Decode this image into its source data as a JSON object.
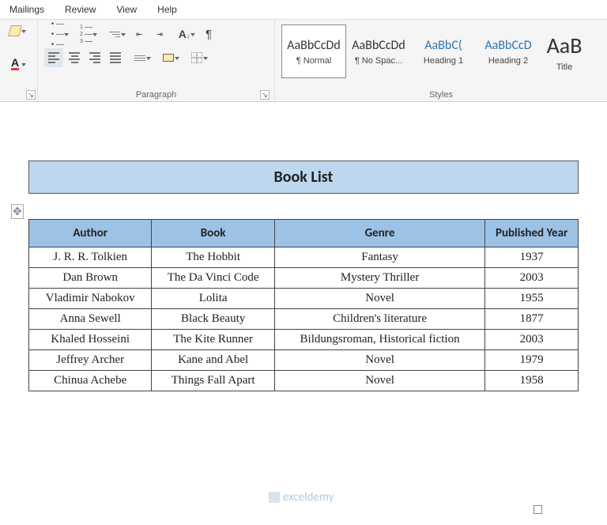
{
  "tabs": {
    "mailings": "Mailings",
    "review": "Review",
    "view": "View",
    "help": "Help"
  },
  "ribbon": {
    "paragraph_label": "Paragraph",
    "styles_label": "Styles"
  },
  "font_color_letter": "A",
  "styles": {
    "normal": {
      "sample": "AaBbCcDd",
      "name": "¶ Normal"
    },
    "nospace": {
      "sample": "AaBbCcDd",
      "name": "¶ No Spac..."
    },
    "h1": {
      "sample": "AaBbC(",
      "name": "Heading 1"
    },
    "h2": {
      "sample": "AaBbCcD",
      "name": "Heading 2"
    },
    "title": {
      "sample": "AaB",
      "name": "Title"
    }
  },
  "doc": {
    "title": "Book List",
    "columns": {
      "author": "Author",
      "book": "Book",
      "genre": "Genre",
      "year": "Published Year"
    },
    "rows": [
      {
        "author": "J. R. R. Tolkien",
        "book": "The Hobbit",
        "genre": "Fantasy",
        "year": "1937"
      },
      {
        "author": "Dan Brown",
        "book": "The Da Vinci Code",
        "genre": "Mystery Thriller",
        "year": "2003"
      },
      {
        "author": "Vladimir Nabokov",
        "book": "Lolita",
        "genre": "Novel",
        "year": "1955"
      },
      {
        "author": "Anna Sewell",
        "book": "Black Beauty",
        "genre": "Children's literature",
        "year": "1877"
      },
      {
        "author": "Khaled Hosseini",
        "book": "The Kite Runner",
        "genre": "Bildungsroman, Historical fiction",
        "year": "2003"
      },
      {
        "author": "Jeffrey Archer",
        "book": "Kane and Abel",
        "genre": "Novel",
        "year": "1979"
      },
      {
        "author": "Chinua Achebe",
        "book": "Things Fall Apart",
        "genre": "Novel",
        "year": "1958"
      }
    ]
  },
  "watermark": "exceldemy",
  "chart_data": {
    "type": "table",
    "title": "Book List",
    "columns": [
      "Author",
      "Book",
      "Genre",
      "Published Year"
    ],
    "rows": [
      [
        "J. R. R. Tolkien",
        "The Hobbit",
        "Fantasy",
        1937
      ],
      [
        "Dan Brown",
        "The Da Vinci Code",
        "Mystery Thriller",
        2003
      ],
      [
        "Vladimir Nabokov",
        "Lolita",
        "Novel",
        1955
      ],
      [
        "Anna Sewell",
        "Black Beauty",
        "Children's literature",
        1877
      ],
      [
        "Khaled Hosseini",
        "The Kite Runner",
        "Bildungsroman, Historical fiction",
        2003
      ],
      [
        "Jeffrey Archer",
        "Kane and Abel",
        "Novel",
        1979
      ],
      [
        "Chinua Achebe",
        "Things Fall Apart",
        "Novel",
        1958
      ]
    ]
  }
}
